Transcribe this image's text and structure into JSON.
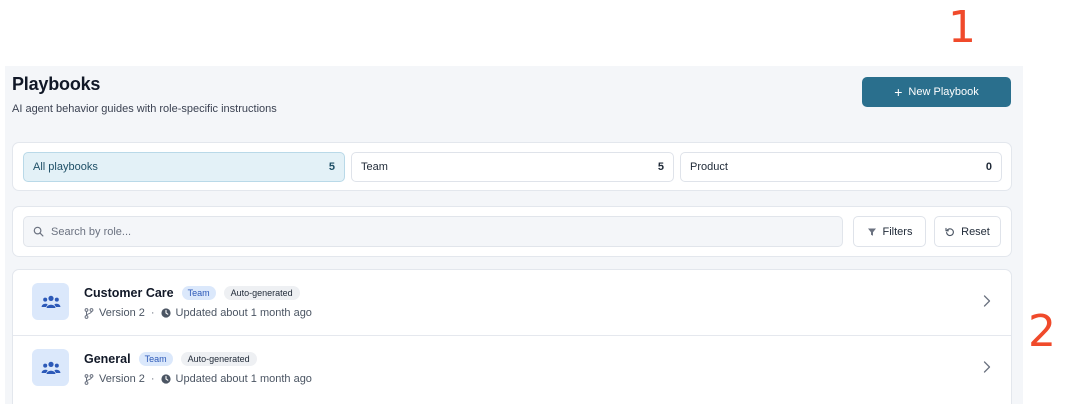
{
  "annotations": {
    "marker_1": "1",
    "marker_2": "2"
  },
  "header": {
    "title": "Playbooks",
    "subtitle": "AI agent behavior guides with role-specific instructions",
    "new_button_label": "New Playbook",
    "new_button_icon": "plus-icon"
  },
  "filters": {
    "tabs": [
      {
        "label": "All playbooks",
        "count": "5",
        "active": true
      },
      {
        "label": "Team",
        "count": "5",
        "active": false
      },
      {
        "label": "Product",
        "count": "0",
        "active": false
      }
    ]
  },
  "search": {
    "placeholder": "Search by role...",
    "value": "",
    "filters_label": "Filters",
    "reset_label": "Reset"
  },
  "playbooks": [
    {
      "name": "Customer Care",
      "type_badge": "Team",
      "auto_badge": "Auto-generated",
      "version": "Version 2",
      "separator": "·",
      "updated": "Updated about 1 month ago"
    },
    {
      "name": "General",
      "type_badge": "Team",
      "auto_badge": "Auto-generated",
      "version": "Version 2",
      "separator": "·",
      "updated": "Updated about 1 month ago"
    }
  ],
  "colors": {
    "primary": "#2a6f8d",
    "active_tab_bg": "#e3f1f7",
    "team_badge_bg": "#dbe8fb",
    "team_badge_text": "#2c59b8",
    "annotation": "#f04a2b"
  }
}
